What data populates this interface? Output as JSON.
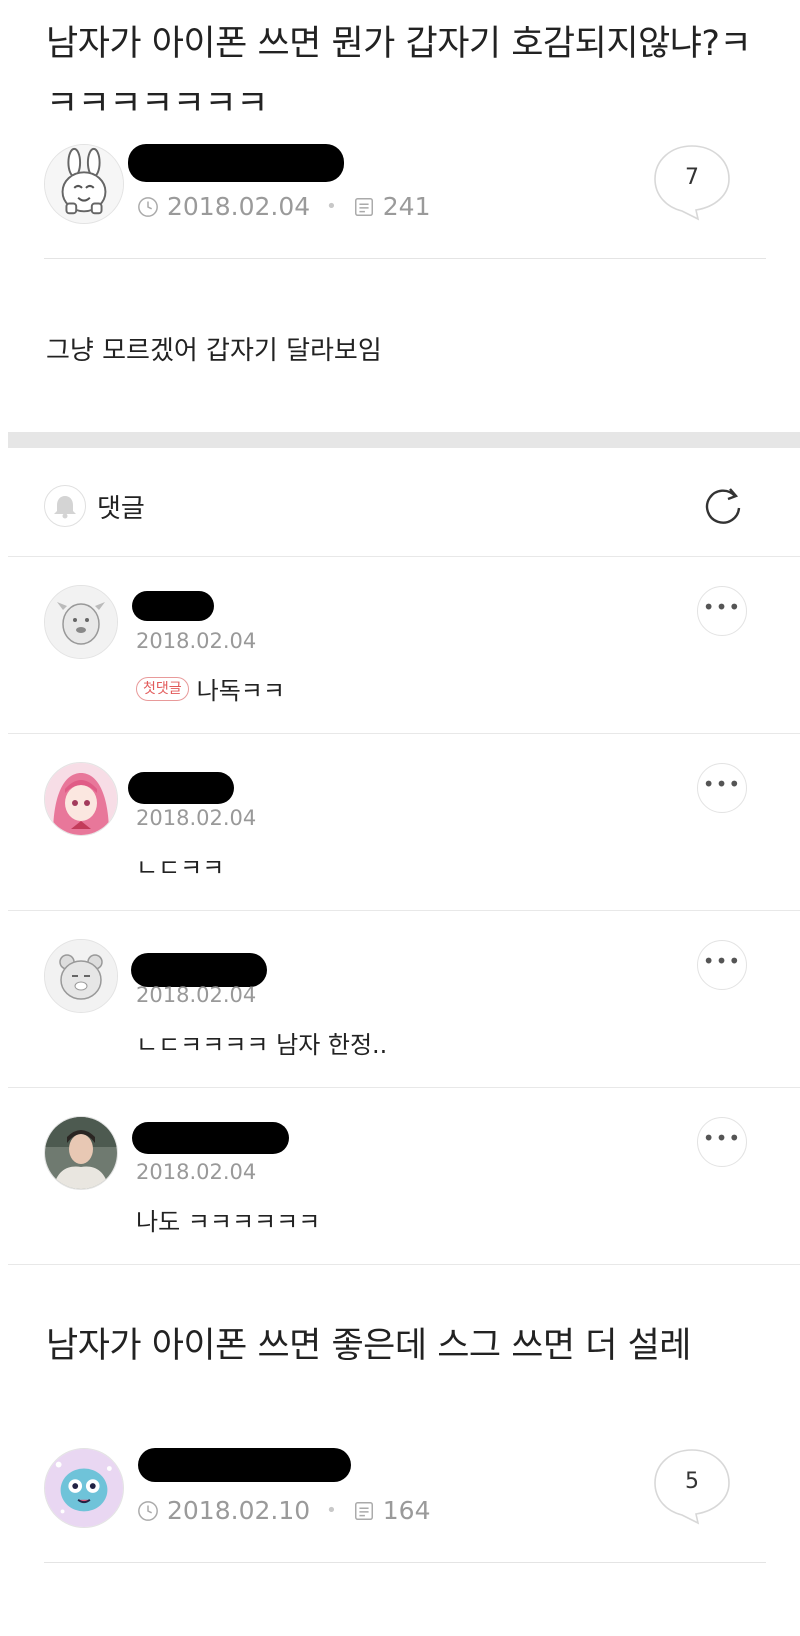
{
  "post1": {
    "title": "남자가 아이폰 쓰면 뭔가 갑자기 호감되지않냐?ㅋㅋㅋㅋㅋㅋㅋㅋ",
    "date": "2018.02.04",
    "views": "241",
    "comment_count": "7",
    "body": "그냥 모르겠어 갑자기 달라보임"
  },
  "comments_section": {
    "label": "댓글"
  },
  "comments": [
    {
      "date": "2018.02.04",
      "badge": "첫댓글",
      "text": "나독ㅋㅋ"
    },
    {
      "date": "2018.02.04",
      "text": "ㄴㄷㅋㅋ"
    },
    {
      "date": "2018.02.04",
      "text": "ㄴㄷㅋㅋㅋㅋ 남자 한정.."
    },
    {
      "date": "2018.02.04",
      "text": "나도 ㅋㅋㅋㅋㅋㅋ"
    }
  ],
  "post2": {
    "title": "남자가 아이폰 쓰면 좋은데 스그 쓰면 더 설레",
    "date": "2018.02.10",
    "views": "164",
    "comment_count": "5"
  },
  "colors": {
    "badge": "#e25a5a",
    "meta_gray": "#9a9a9a",
    "band_gray": "#e6e6e6"
  }
}
